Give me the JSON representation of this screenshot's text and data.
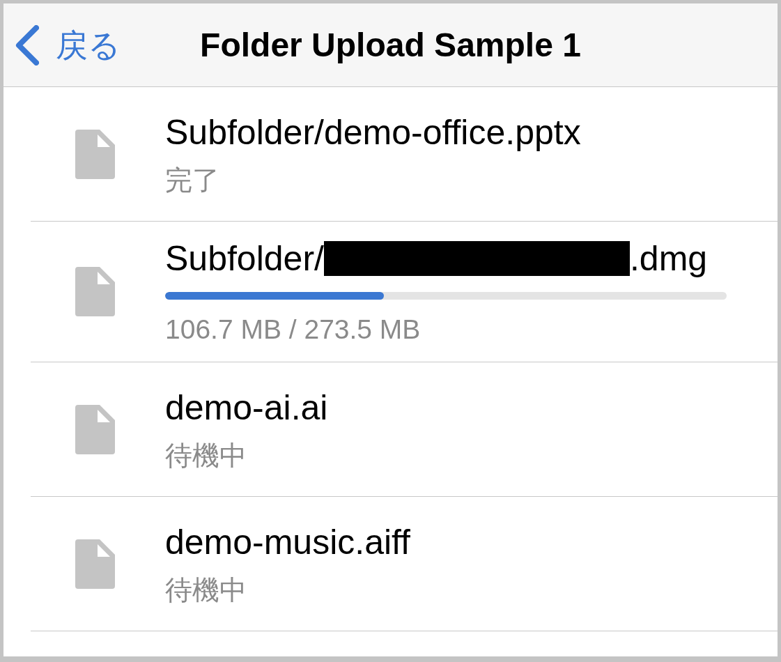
{
  "nav": {
    "back_label": "戻る",
    "title": "Folder Upload Sample 1"
  },
  "files": [
    {
      "kind": "status",
      "name": "Subfolder/demo-office.pptx",
      "redacted": false,
      "status": "完了"
    },
    {
      "kind": "progress",
      "name": "Subfolder/",
      "redacted": true,
      "name_suffix": ".dmg",
      "level": 0.39,
      "status": "106.7 MB / 273.5 MB"
    },
    {
      "kind": "status",
      "name": "demo-ai.ai",
      "redacted": false,
      "status": "待機中"
    },
    {
      "kind": "status",
      "name": "demo-music.aiff",
      "redacted": false,
      "status": "待機中"
    }
  ]
}
